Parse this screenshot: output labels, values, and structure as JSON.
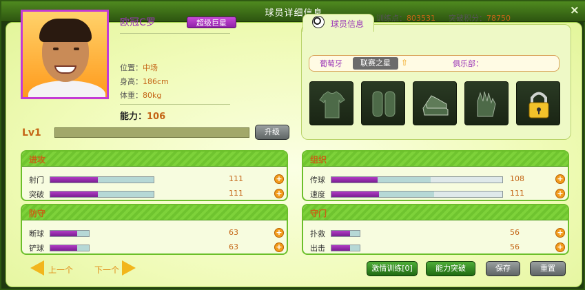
{
  "window": {
    "title": "球员详细信息",
    "close": "×"
  },
  "player": {
    "name": "欧冠C罗",
    "badge": "超级巨星",
    "position_label": "位置：",
    "position": "中场",
    "height_label": "身高：",
    "height": "186cm",
    "weight_label": "体重：",
    "weight": "80kg",
    "power_label": "能力：",
    "power": "106",
    "level": "Lv1",
    "upgrade": "升级"
  },
  "header_stats": {
    "training_label": "训练点：",
    "training": "803531",
    "breakthrough_label": "突破积分：",
    "breakthrough": "78750"
  },
  "info_card": {
    "tab": "球员信息",
    "country": "葡萄牙",
    "league": "联赛之星",
    "club_label": "俱乐部：",
    "club": ""
  },
  "equipment": [
    "jersey-icon",
    "shin-guard-icon",
    "boots-icon",
    "gloves-icon",
    "lock-icon"
  ],
  "sections": [
    {
      "title": "进攻",
      "rows": [
        {
          "label": "射门",
          "value": "111",
          "fill": 0.46
        },
        {
          "label": "突破",
          "value": "111",
          "fill": 0.46
        }
      ]
    },
    {
      "title": "组织",
      "rows": [
        {
          "label": "传球",
          "value": "108",
          "fill": 0.27
        },
        {
          "label": "速度",
          "value": "111",
          "fill": 0.28
        }
      ]
    },
    {
      "title": "防守",
      "rows": [
        {
          "label": "断球",
          "value": "63",
          "fill": 0.69
        },
        {
          "label": "铲球",
          "value": "63",
          "fill": 0.69
        }
      ]
    },
    {
      "title": "守门",
      "rows": [
        {
          "label": "扑救",
          "value": "56",
          "fill": 0.65
        },
        {
          "label": "出击",
          "value": "56",
          "fill": 0.65
        }
      ]
    }
  ],
  "footer": {
    "prev": "上一个",
    "next": "下一个",
    "passion_training": "激情训练[0]",
    "ability_breakthrough": "能力突破",
    "save": "保存",
    "reset": "重置"
  },
  "colors": {
    "accent": "#c46516",
    "purple": "#9b36b8",
    "green": "#6bbf2a"
  }
}
